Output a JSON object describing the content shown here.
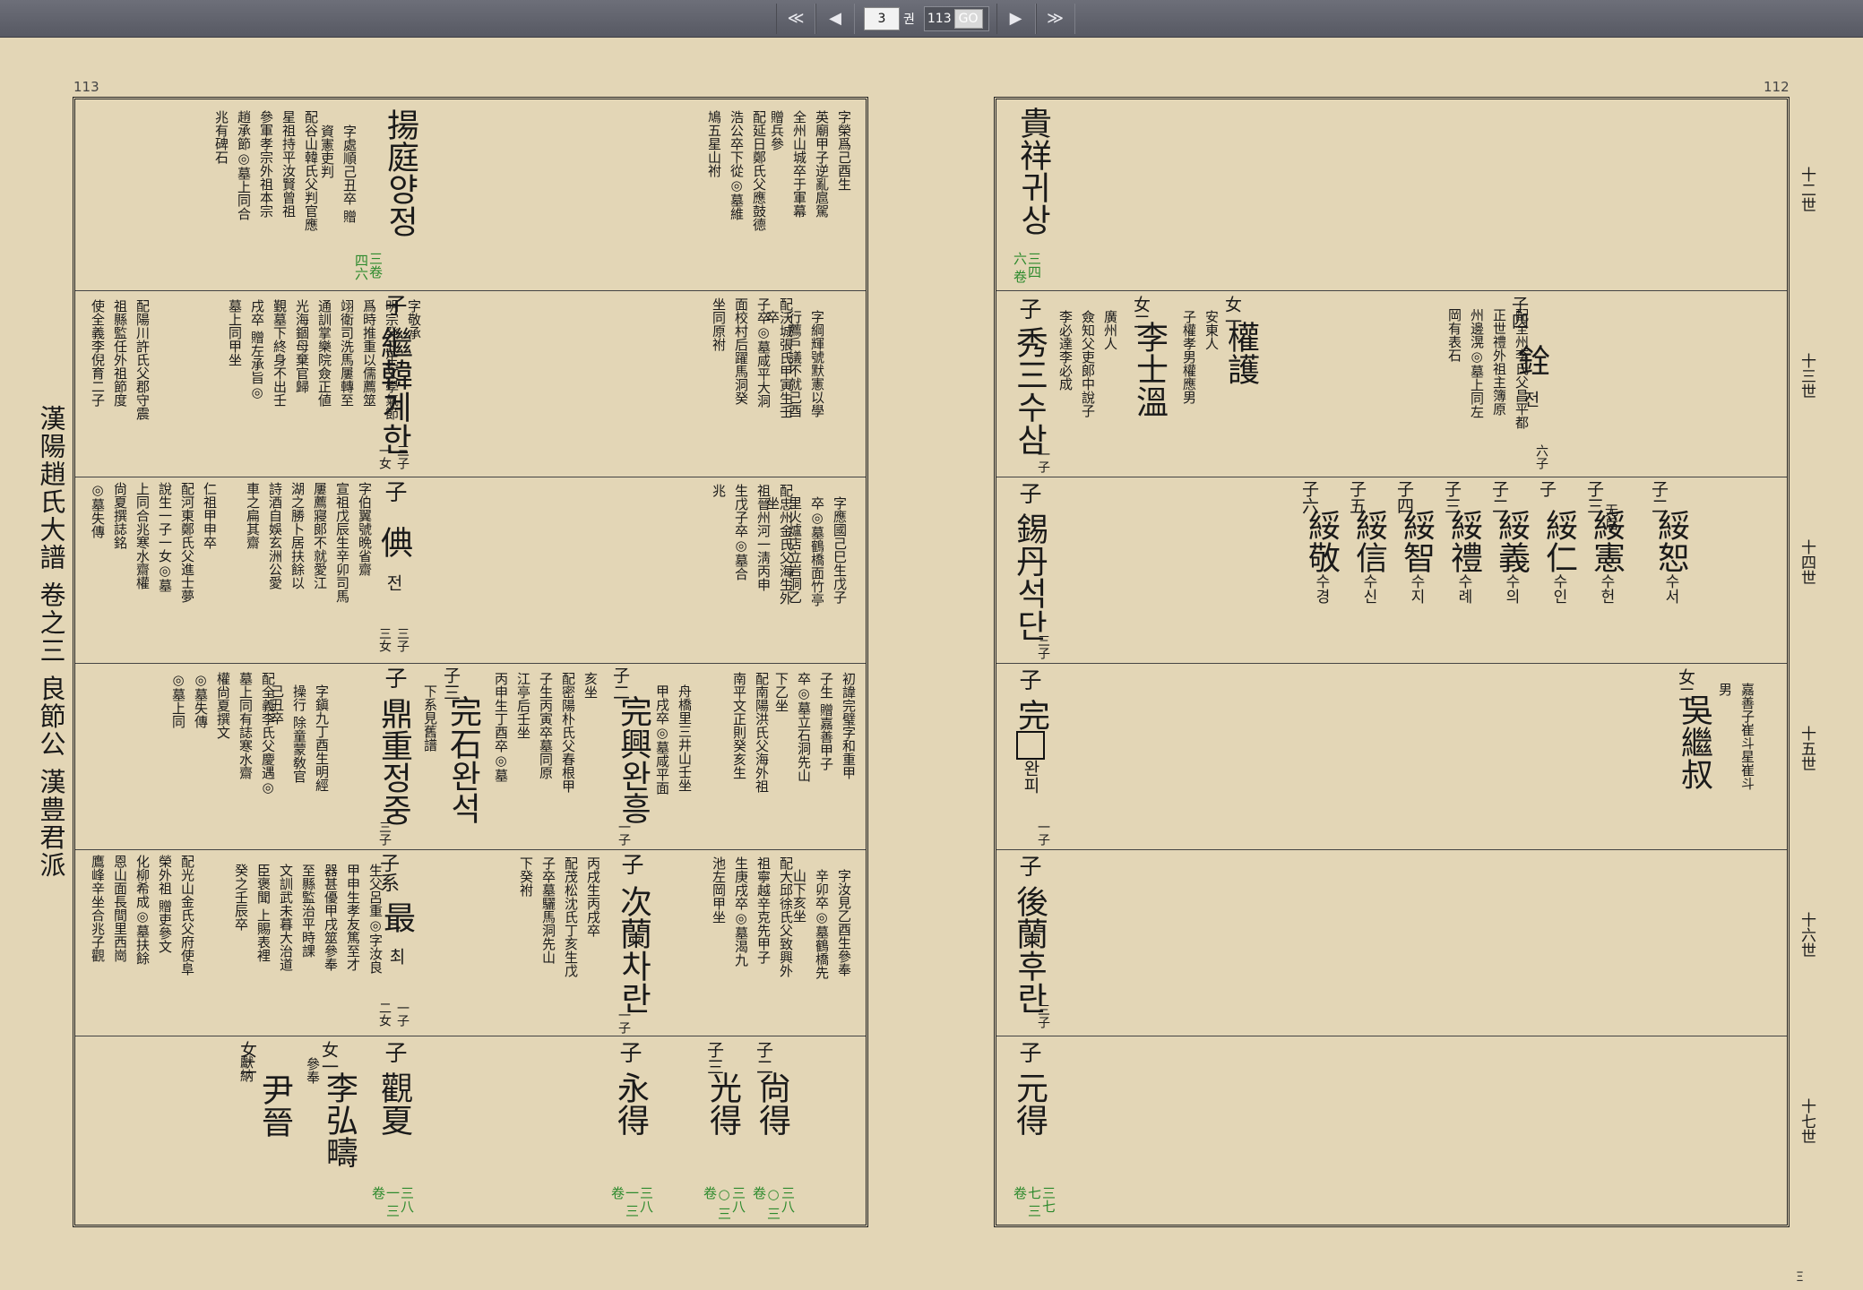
{
  "toolbar": {
    "first": "≪",
    "prev": "◀",
    "current_volume": "3",
    "volume_unit": "권",
    "total_pages": "113",
    "go": "GO",
    "next": "▶",
    "last": "≫"
  },
  "side_title": "漢陽趙氏大譜 卷之三 良節公 漢豊君派",
  "page_left_number": "113",
  "page_right_number": "112",
  "corner_mark": "Ξ",
  "generations": [
    "十二世",
    "十三世",
    "十四世",
    "十五世",
    "十六世",
    "十七世"
  ],
  "left": {
    "r1": {
      "name": "揚庭",
      "hg": "양정",
      "ref": "三四六 卷",
      "ref_parts": [
        "三卷",
        "四六"
      ],
      "note1": "字處順己丑卒  贈\n資憲吏判",
      "note2": "配谷山韓氏父判官應\n星祖持平汝賢曾祖\n參軍孝宗外祖本宗\n趙承節◎墓上同合\n兆有碑石",
      "top_col1": "字榮爲己酉生\n英廟甲子逆亂扈駕\n全州山城卒于軍幕\n贈兵參",
      "top_col2": "配延日鄭氏父應鼓德\n浩公卒下從◎墓維\n鳩五星山祔"
    },
    "r2": {
      "rel": "子",
      "name": "繼韓",
      "hg": "계한",
      "cnt": "三子 一女",
      "col1": "字敬承\n明宗癸丑生文學氣節\n爲時推重以儒薦筮\n翊衛司洗馬屢轉至\n通訓掌樂院僉正値\n光海錮母棄官歸\n覲墓下終身不出壬\n戌卒 贈左承旨◎\n墓上同甲坐",
      "col2": "配陽川許氏父郡守震\n祖縣監任外祖節度\n使全義李倪育二子",
      "col3": "字綱輝號默憲以學\n行薦戶議不就己酉\n卒",
      "col4": "配沃城張氏甲寅生壬\n子卒◎墓咸平大洞\n面校村后躍馬洞癸\n坐同原祔"
    },
    "r3": {
      "rel": "子",
      "name": "倎",
      "hg": "전",
      "cnt": "三子 三女",
      "col1": "字伯翼號晩省齋\n宣祖戊辰生辛卯司馬\n屢薦寢郞不就愛江\n湖之勝卜居扶餘以\n詩酒自娛玄洲公愛\n車之扁其齋",
      "col2": "仁祖甲申卒\n配河東鄭氏父進士夢\n說生一子一女◎墓\n上同合兆寒水齋權\n尙夏撰誌銘\n◎墓失傳",
      "col3": "字應國己巳生戊子\n卒◎墓鶴橋面竹亭\n里火爐店立岩洞乙\n坐",
      "col4": "配忠州金氏父海生外\n祖晉州河一淸丙申\n生戊子卒◎墓合\n兆"
    },
    "r4": {
      "a_rel": "子",
      "a_name": "鼎重",
      "a_hg": "정중",
      "a_cnt": "三子",
      "a_col1": "字鎭九丁酉生明經\n操行 除童蒙敎官\n己丑卒",
      "a_col2": "配全義李氏父慶遇◎\n墓上同有誌寒水齋\n權尙夏撰文\n◎墓失傳\n◎墓上同",
      "b_rel": "子三",
      "b_name": "完石",
      "b_hg": "완석",
      "b_col": "下系見舊譜",
      "c_rel": "子二",
      "c_name": "完興",
      "c_hg": "완흥",
      "c_cnt": "一子",
      "c_col1": "亥坐\n配密陽朴氏父春根甲\n子生丙寅卒墓同原\n江亭后壬坐\n丙申生丁酉卒◎墓",
      "c_col2": "舟橋里三井山壬坐\n甲戌卒◎墓咸平面",
      "d_col1": "初諱完璧字和重甲\n子生 贈嘉善甲子\n卒◎墓立石洞先山\n下乙坐",
      "d_col2": "配南陽洪氏父海外祖\n南平文正則癸亥生"
    },
    "r5": {
      "a_rel": "子系",
      "a_name": "最",
      "a_hg": "최",
      "a_cnt": "一子 二女",
      "a_col1": "生父呂重◎字汝良\n甲申生孝友篤至才\n器甚優甲戌筮參奉\n至縣監治平時課\n文訓武未暮大治道\n臣褒聞 上賜表裡\n癸之壬辰卒",
      "a_col2": "配光山金氏父府使阜\n榮外祖 贈吏參文\n化柳希成◎墓扶餘\n恩山面長間里西崗\n鷹峰辛坐合兆子觀",
      "b_rel": "子",
      "b_name": "次蘭",
      "b_hg": "차란",
      "b_cnt": "一子",
      "b_col1": "丙戌生丙戌卒\n配茂松沈氏丁亥生戊\n子卒墓驪馬洞先山\n下癸祔",
      "b_col2": "字汝見乙酉生參奉\n辛卯卒◎墓鶴橋先\n山下亥坐",
      "b_col3": "配大邱徐氏父致興外\n祖寧越辛克先甲子\n生庚戌卒◎墓渴九\n池左岡甲坐"
    },
    "r6": {
      "a_rel": "女二",
      "a_name": "尹晉",
      "a_note": "獻納",
      "b_rel": "女一",
      "b_name": "李弘疇",
      "b_note": "參奉",
      "c_rel": "子",
      "c_name": "觀夏",
      "c_ref": "三八一 三卷",
      "d_rel": "子",
      "d_name": "永得",
      "d_ref": "三八一 三卷",
      "e_rel": "子三",
      "e_name": "光得",
      "e_ref": "三八○ 三卷",
      "f_rel": "子二",
      "f_name": "尙得",
      "f_ref": "三八○ 三卷"
    }
  },
  "right": {
    "r1": {
      "name": "貴祥",
      "hg": "귀상",
      "ref": "三四六 卷"
    },
    "r2": {
      "a_rel": "子",
      "a_name": "秀三",
      "a_hg": "수삼",
      "a_cnt": "一子",
      "b_rel": "女二",
      "b_name": "李士溫",
      "b_note": "廣州人\n僉知父吏郞中說子\n李必達李必成",
      "c_rel": "女一",
      "c_name": "權護",
      "c_note": "安東人\n子權孝男權應男",
      "d_rel": "子四",
      "d_name": "銓",
      "d_hg": "전",
      "d_cnt": "六子",
      "d_col": "配全州李氏父昌平都\n正世禮外祖主簿原\n州邊滉◎墓上同左\n岡有表石"
    },
    "r3": {
      "a_rel": "子",
      "a_name": "錫丹",
      "a_hg": "석단",
      "a_cnt": "三子",
      "sons": [
        {
          "rel": "子六",
          "name": "綏敬",
          "hg": "수경"
        },
        {
          "rel": "子五",
          "name": "綏信",
          "hg": "수신"
        },
        {
          "rel": "子四",
          "name": "綏智",
          "hg": "수지"
        },
        {
          "rel": "子三",
          "name": "綏禮",
          "hg": "수례"
        },
        {
          "rel": "子二",
          "name": "綏義",
          "hg": "수의"
        },
        {
          "rel": "子",
          "name": "綏仁",
          "hg": "수인"
        },
        {
          "rel": "子三",
          "name": "綏憲",
          "hg": "수헌"
        },
        {
          "rel": "子二",
          "name": "綏恕",
          "hg": "수서"
        }
      ],
      "no_heir": "无后"
    },
    "r4": {
      "a_rel": "子",
      "a_name": "完",
      "a_hg": "완피",
      "a_cnt": "一子",
      "b_rel": "女二",
      "b_name": "吳繼叔",
      "b_note": "嘉善子崔斗星崔斗\n男"
    },
    "r5": {
      "a_rel": "子",
      "a_name": "後蘭",
      "a_hg": "후란",
      "a_cnt": "三子"
    },
    "r6": {
      "a_rel": "子",
      "a_name": "元得",
      "a_ref": "三七七 三卷"
    }
  }
}
